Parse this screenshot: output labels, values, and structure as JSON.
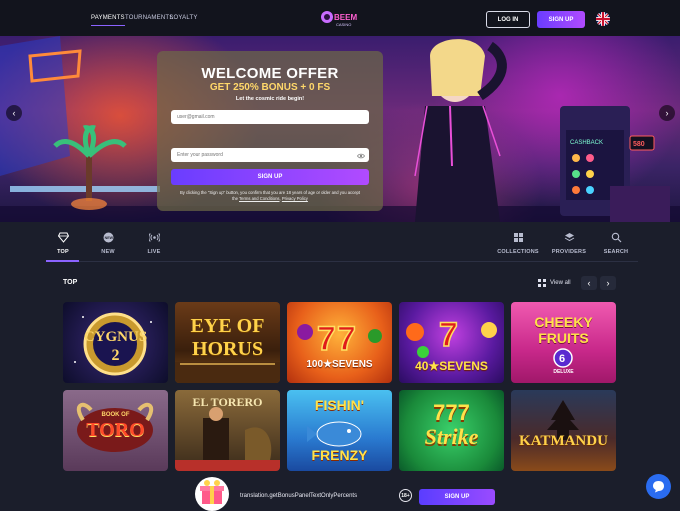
{
  "nav": {
    "links": [
      "PAYMENTS",
      "TOURNAMENTS",
      "LOYALTY"
    ],
    "logo_text": "BEEM",
    "logo_subtext": "CASINO",
    "login_label": "LOG IN",
    "signup_label": "SIGN UP",
    "language_icon": "uk-flag-icon"
  },
  "hero": {
    "title": "WELCOME OFFER",
    "bonus": "GET 250% BONUS + 0 FS",
    "subtitle": "Let the cosmic ride begin!",
    "email_placeholder": "user@gmail.com",
    "password_placeholder": "Enter your password",
    "signup_label": "SIGN UP",
    "legal_prefix": "By clicking the \"Sign up\" button, you confirm that you are 18 years of age or older and you accept the",
    "terms_link": "Terms and Conditions",
    "privacy_link": "Privacy Policy"
  },
  "categories": {
    "left": [
      {
        "label": "TOP",
        "icon": "diamond-icon"
      },
      {
        "label": "NEW",
        "icon": "new-badge-icon"
      },
      {
        "label": "LIVE",
        "icon": "live-broadcast-icon"
      }
    ],
    "right": [
      {
        "label": "COLLECTIONS",
        "icon": "grid-icon"
      },
      {
        "label": "PROVIDERS",
        "icon": "layers-icon"
      },
      {
        "label": "SEARCH",
        "icon": "search-icon"
      }
    ]
  },
  "section": {
    "title": "TOP",
    "view_all": "View all"
  },
  "games": [
    {
      "line1": "CYGNUS",
      "line2": "2"
    },
    {
      "line1": "EYE OF",
      "line2": "HORUS"
    },
    {
      "line1": "100",
      "line2": "SEVENS"
    },
    {
      "line1": "40",
      "line2": "SEVENS"
    },
    {
      "line1": "CHEEKY",
      "line2": "FRUITS",
      "line3": "DELUXE"
    },
    {
      "line1": "BOOK OF",
      "line2": "TORO"
    },
    {
      "line1": "EL TORERO",
      "line2": ""
    },
    {
      "line1": "FISHIN'",
      "line2": "FRENZY"
    },
    {
      "line1": "777",
      "line2": "Strike"
    },
    {
      "line1": "KATMANDU",
      "line2": ""
    }
  ],
  "bottom": {
    "bonus_text": "translation.getBonusPanelTextOnlyPercents",
    "age": "18+",
    "signup_label": "SIGN UP"
  },
  "colors": {
    "accent": "#8b63ff",
    "signup_gradient_start": "#6a3dff",
    "signup_gradient_end": "#b14bff",
    "background": "#1b1e2b",
    "chat": "#2a6cf0"
  }
}
